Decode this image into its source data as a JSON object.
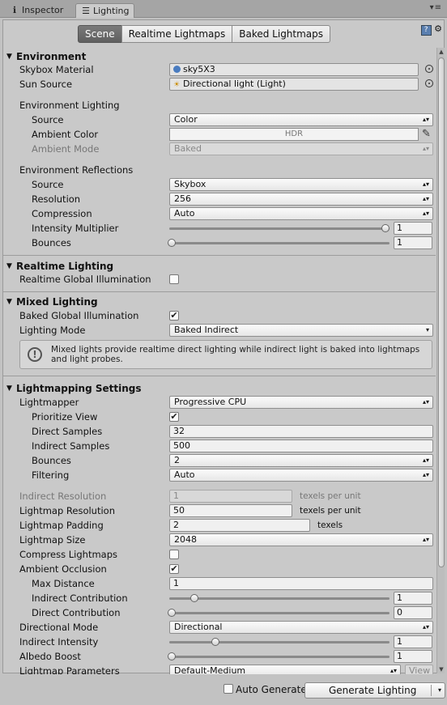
{
  "tabs": [
    {
      "label": "Inspector",
      "icon": "info-icon"
    },
    {
      "label": "Lighting",
      "icon": "sliders-icon"
    }
  ],
  "modes": [
    "Scene",
    "Realtime Lightmaps",
    "Baked Lightmaps"
  ],
  "sections": {
    "environment": "Environment",
    "realtime": "Realtime Lighting",
    "mixed": "Mixed Lighting",
    "lightmapping": "Lightmapping Settings"
  },
  "env": {
    "skybox_label": "Skybox Material",
    "skybox_value": "sky5X3",
    "sun_label": "Sun Source",
    "sun_value": "Directional light (Light)",
    "lighting_header": "Environment Lighting",
    "source_label": "Source",
    "source_value": "Color",
    "ambient_color_label": "Ambient Color",
    "ambient_color_value": "HDR",
    "ambient_mode_label": "Ambient Mode",
    "ambient_mode_value": "Baked",
    "reflections_header": "Environment Reflections",
    "refl_source_label": "Source",
    "refl_source_value": "Skybox",
    "resolution_label": "Resolution",
    "resolution_value": "256",
    "compression_label": "Compression",
    "compression_value": "Auto",
    "intensity_label": "Intensity Multiplier",
    "intensity_value": "1",
    "bounces_label": "Bounces",
    "bounces_value": "1"
  },
  "realtime": {
    "gi_label": "Realtime Global Illumination"
  },
  "mixed": {
    "baked_gi_label": "Baked Global Illumination",
    "lighting_mode_label": "Lighting Mode",
    "lighting_mode_value": "Baked Indirect",
    "help_text": "Mixed lights provide realtime direct lighting while indirect light is baked into lightmaps and light probes."
  },
  "lm": {
    "lightmapper_label": "Lightmapper",
    "lightmapper_value": "Progressive CPU",
    "prioritize_label": "Prioritize View",
    "direct_samples_label": "Direct Samples",
    "direct_samples_value": "32",
    "indirect_samples_label": "Indirect Samples",
    "indirect_samples_value": "500",
    "bounces_label": "Bounces",
    "bounces_value": "2",
    "filtering_label": "Filtering",
    "filtering_value": "Auto",
    "indirect_res_label": "Indirect Resolution",
    "indirect_res_value": "1",
    "indirect_res_unit": "texels per unit",
    "lightmap_res_label": "Lightmap Resolution",
    "lightmap_res_value": "50",
    "lightmap_res_unit": "texels per unit",
    "padding_label": "Lightmap Padding",
    "padding_value": "2",
    "padding_unit": "texels",
    "size_label": "Lightmap Size",
    "size_value": "2048",
    "compress_label": "Compress Lightmaps",
    "ao_label": "Ambient Occlusion",
    "max_distance_label": "Max Distance",
    "max_distance_value": "1",
    "indirect_contrib_label": "Indirect Contribution",
    "indirect_contrib_value": "1",
    "direct_contrib_label": "Direct Contribution",
    "direct_contrib_value": "0",
    "directional_label": "Directional Mode",
    "directional_value": "Directional",
    "indirect_intensity_label": "Indirect Intensity",
    "indirect_intensity_value": "1",
    "albedo_label": "Albedo Boost",
    "albedo_value": "1",
    "params_label": "Lightmap Parameters",
    "params_value": "Default-Medium",
    "view_label": "View"
  },
  "footer": {
    "auto_generate_label": "Auto Generate",
    "generate_label": "Generate Lighting"
  }
}
